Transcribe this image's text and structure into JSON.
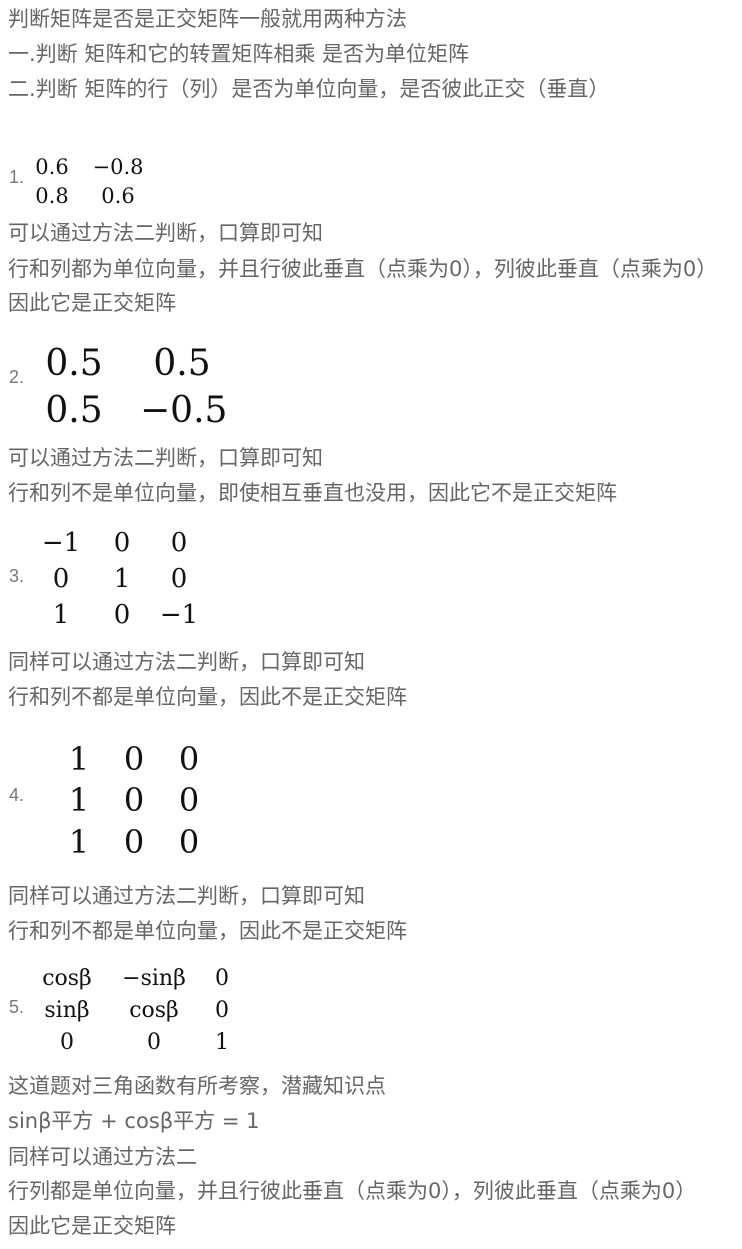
{
  "intro": {
    "title": " 判断矩阵是否是正交矩阵一般就用两种方法",
    "method1": "一.判断 矩阵和它的转置矩阵相乘 是否为单位矩阵",
    "method2": "二.判断 矩阵的行（列）是否为单位向量，是否彼此正交（垂直）"
  },
  "problems": [
    {
      "label": "1.",
      "matrix": [
        [
          "0.6",
          "−0.8"
        ],
        [
          "0.8",
          "0.6"
        ]
      ],
      "text": [
        "可以通过方法二判断，口算即可知",
        "行和列都为单位向量，并且行彼此垂直（点乘为0），列彼此垂直（点乘为0）",
        "因此它是正交矩阵"
      ]
    },
    {
      "label": "2.",
      "matrix": [
        [
          "0.5",
          "0.5"
        ],
        [
          "0.5",
          "−0.5"
        ]
      ],
      "text": [
        "可以通过方法二判断，口算即可知",
        "行和列不是单位向量，即使相互垂直也没用，因此它不是正交矩阵"
      ]
    },
    {
      "label": "3.",
      "matrix": [
        [
          "−1",
          "0",
          "0"
        ],
        [
          "0",
          "1",
          "0"
        ],
        [
          "1",
          "0",
          "−1"
        ]
      ],
      "text": [
        "同样可以通过方法二判断，口算即可知",
        "行和列不都是单位向量，因此不是正交矩阵"
      ]
    },
    {
      "label": "4.",
      "matrix": [
        [
          "1",
          "0",
          "0"
        ],
        [
          "1",
          "0",
          "0"
        ],
        [
          "1",
          "0",
          "0"
        ]
      ],
      "text": [
        "同样可以通过方法二判断，口算即可知",
        "行和列不都是单位向量，因此不是正交矩阵"
      ]
    },
    {
      "label": "5.",
      "matrix": [
        [
          "cosβ",
          "−sinβ",
          "0"
        ],
        [
          "sinβ",
          "cosβ",
          "0"
        ],
        [
          "0",
          "0",
          "1"
        ]
      ],
      "text": [
        "这道题对三角函数有所考察，潜藏知识点",
        "sinβ平方 + cosβ平方 = 1",
        "同样可以通过方法二",
        "行列都是单位向量，并且行彼此垂直（点乘为0），列彼此垂直（点乘为0）",
        "因此它是正交矩阵"
      ]
    }
  ]
}
